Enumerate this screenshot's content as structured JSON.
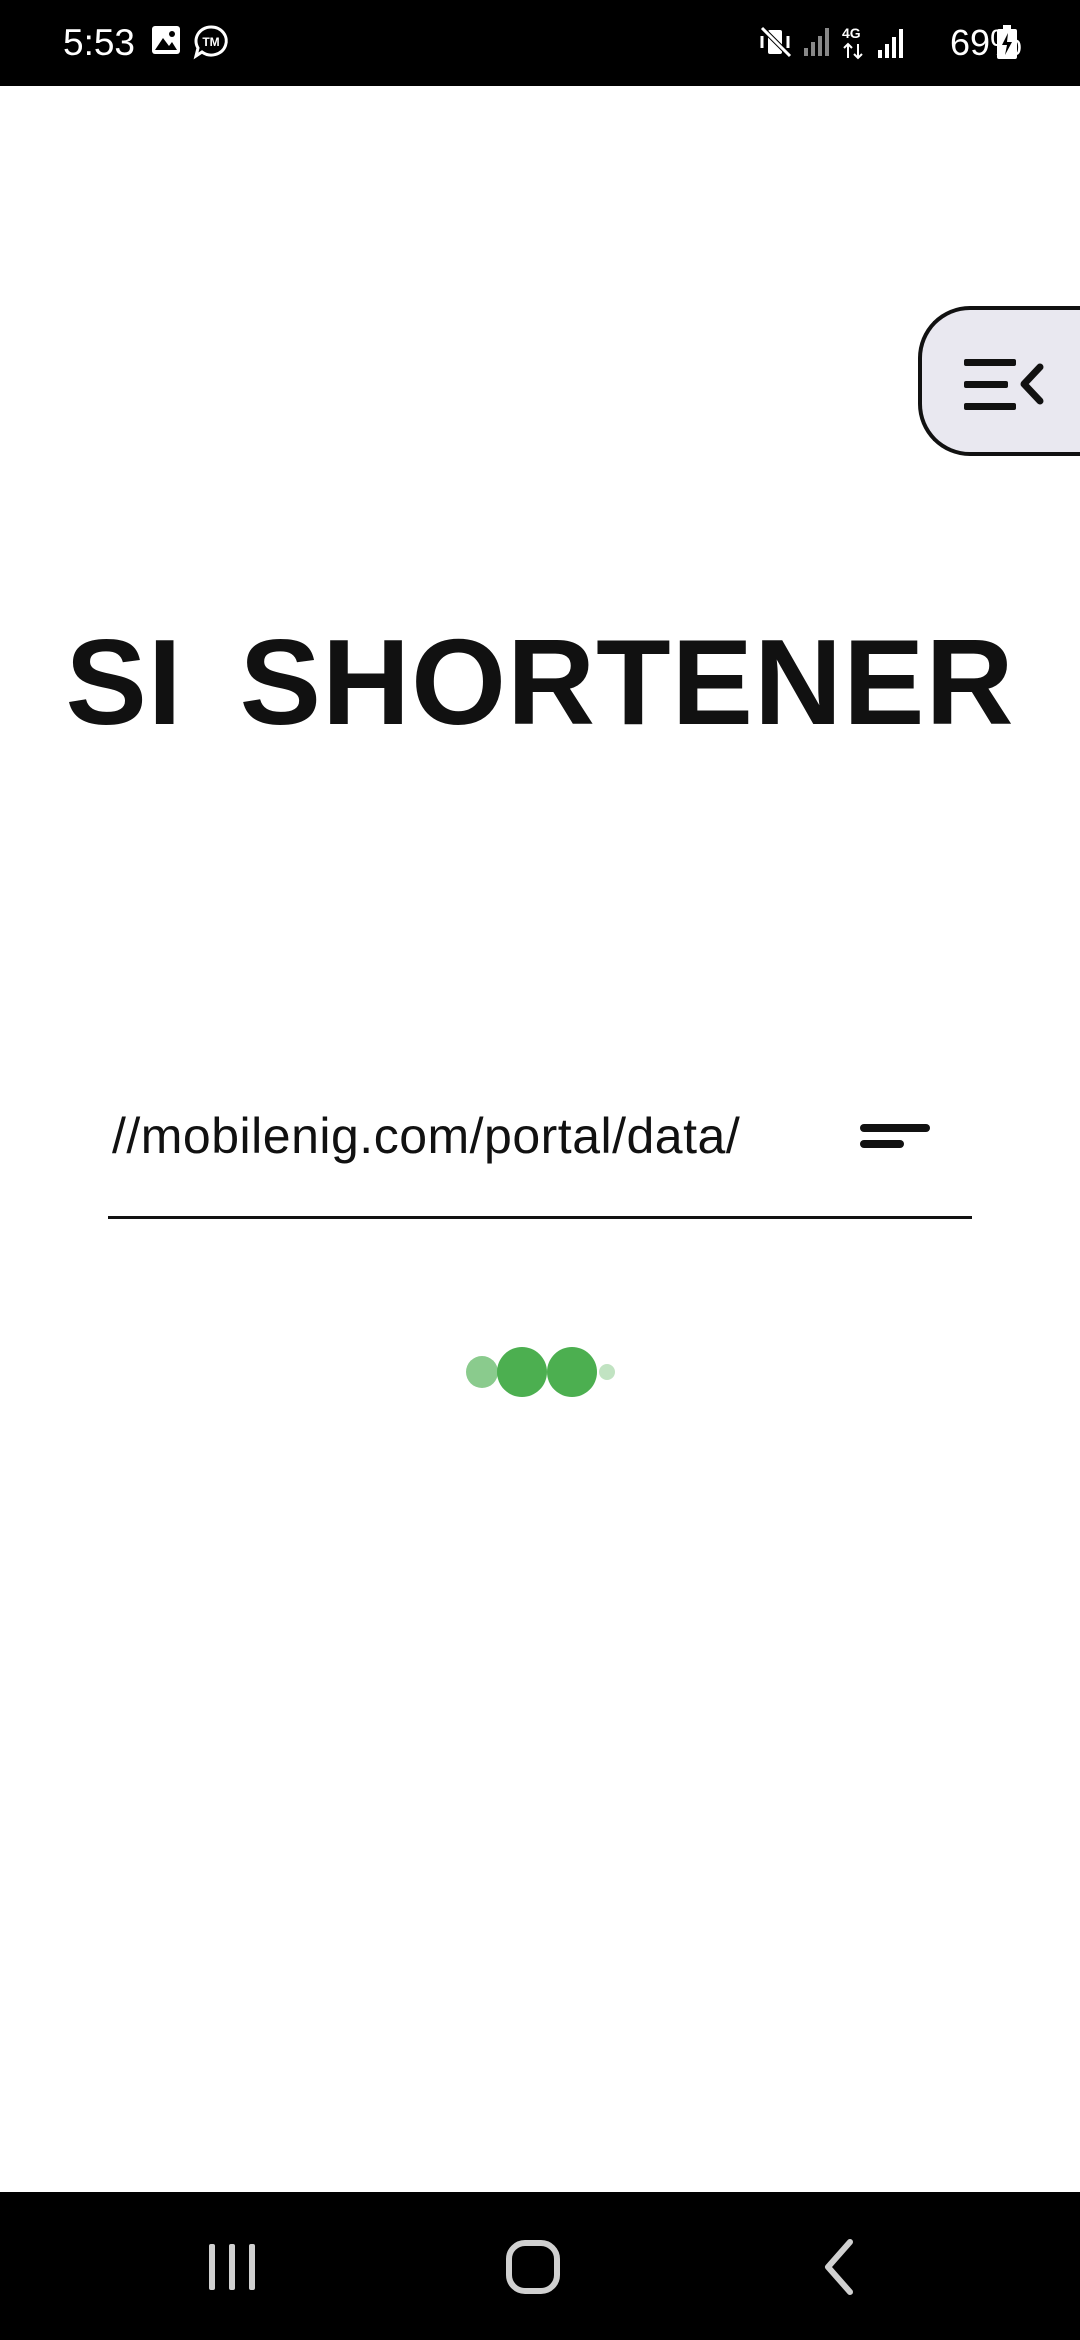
{
  "status_bar": {
    "time": "5:53",
    "battery": "69%",
    "icons": [
      "gallery-icon",
      "tm-notification-icon",
      "mute-vibrate-icon",
      "signal-icon",
      "4g-signal-icon",
      "battery-charging-icon"
    ]
  },
  "app": {
    "title": "SI SHORTENER",
    "menu_icon": "collapse-menu-icon"
  },
  "url_input": {
    "value": "//mobilenig.com/portal/data/",
    "action_icon": "shorten-lines-icon"
  },
  "loader": {
    "color": "#4caf50",
    "icon": "loading-dots"
  },
  "nav_bar": {
    "items": [
      "recent-apps",
      "home",
      "back"
    ]
  }
}
